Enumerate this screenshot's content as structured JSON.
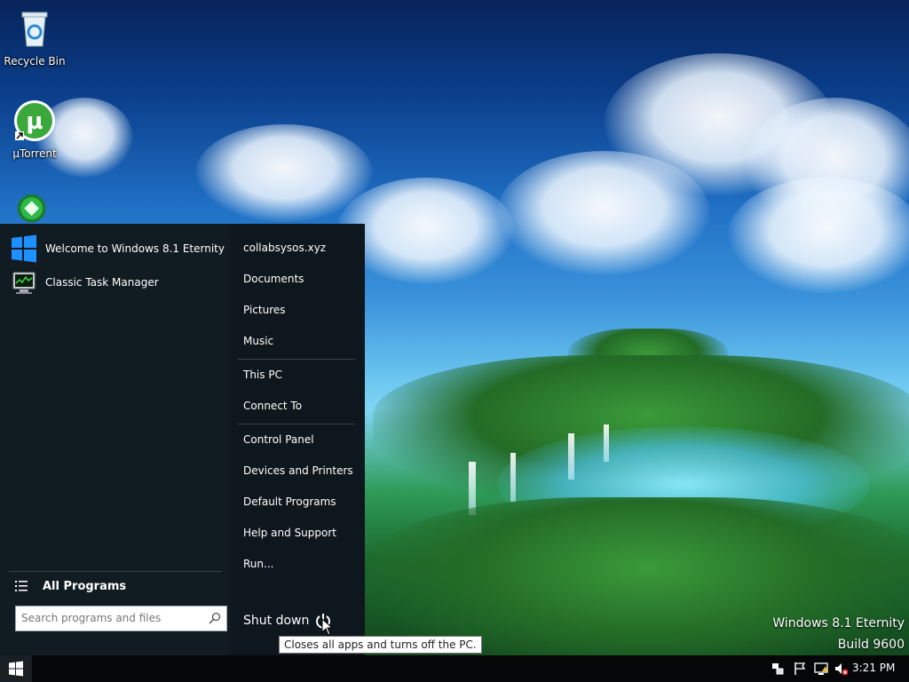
{
  "desktop": {
    "icons": [
      {
        "label": "Recycle Bin",
        "icon": "recycle-bin-icon"
      },
      {
        "label": "µTorrent",
        "icon": "utorrent-icon"
      },
      {
        "label": "",
        "icon": "green-orb-icon"
      }
    ],
    "watermark": {
      "line1": "Windows 8.1 Eternity",
      "line2": "Build 9600"
    }
  },
  "start_menu": {
    "pinned": [
      {
        "label": "Welcome to Windows 8.1 Eternity",
        "icon": "windows-logo-icon"
      },
      {
        "label": "Classic Task Manager",
        "icon": "task-manager-icon"
      }
    ],
    "all_programs": "All Programs",
    "search_placeholder": "Search programs and files",
    "right_links": [
      "collabsysos.xyz",
      "Documents",
      "Pictures",
      "Music",
      "This PC",
      "Connect To",
      "Control Panel",
      "Devices and Printers",
      "Default Programs",
      "Help and Support",
      "Run..."
    ],
    "shutdown_label": "Shut down",
    "tooltip": "Closes all apps and turns off the PC."
  },
  "taskbar": {
    "clock": "3:21 PM",
    "tray_icons": [
      "network-devices-icon",
      "flag-icon",
      "network-icon",
      "volume-muted-icon"
    ]
  }
}
